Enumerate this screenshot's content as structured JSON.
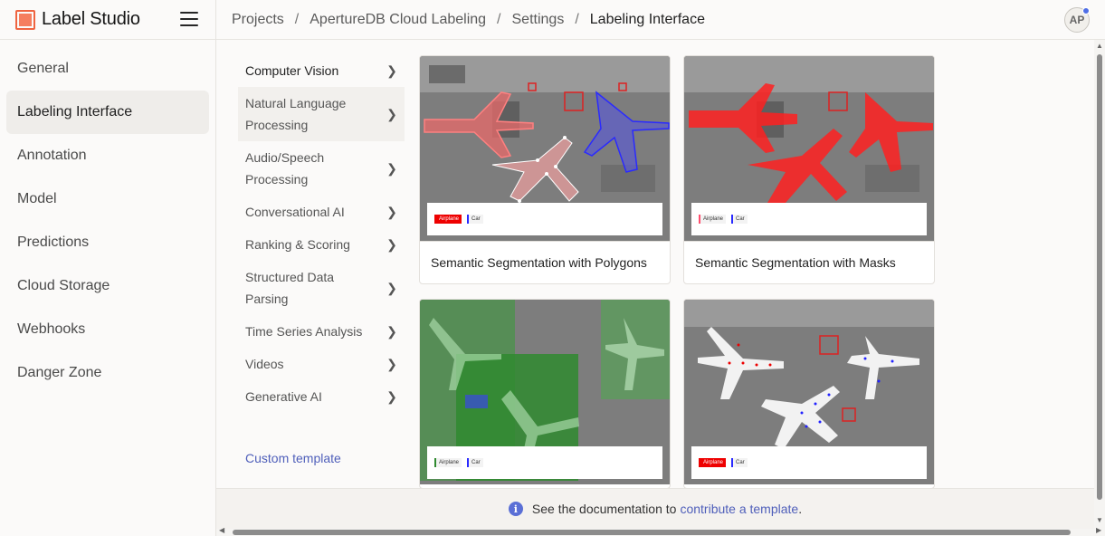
{
  "app": {
    "name": "Label Studio"
  },
  "breadcrumb": [
    "Projects",
    "ApertureDB Cloud Labeling",
    "Settings",
    "Labeling Interface"
  ],
  "breadcrumb_sep": "/",
  "user": {
    "initials": "AP"
  },
  "settings_nav": [
    {
      "label": "General",
      "active": false
    },
    {
      "label": "Labeling Interface",
      "active": true
    },
    {
      "label": "Annotation",
      "active": false
    },
    {
      "label": "Model",
      "active": false
    },
    {
      "label": "Predictions",
      "active": false
    },
    {
      "label": "Cloud Storage",
      "active": false
    },
    {
      "label": "Webhooks",
      "active": false
    },
    {
      "label": "Danger Zone",
      "active": false
    }
  ],
  "categories": [
    {
      "label": "Computer Vision",
      "active": true
    },
    {
      "label": "Natural Language Processing",
      "active": false
    },
    {
      "label": "Audio/Speech Processing",
      "active": false
    },
    {
      "label": "Conversational AI",
      "active": false
    },
    {
      "label": "Ranking & Scoring",
      "active": false
    },
    {
      "label": "Structured Data Parsing",
      "active": false
    },
    {
      "label": "Time Series Analysis",
      "active": false
    },
    {
      "label": "Videos",
      "active": false
    },
    {
      "label": "Generative AI",
      "active": false
    }
  ],
  "custom_template": "Custom template",
  "templates": [
    {
      "title": "Semantic Segmentation with Polygons",
      "labels": [
        "Airplane",
        "Car"
      ]
    },
    {
      "title": "Semantic Segmentation with Masks",
      "labels": [
        "Airplane",
        "Car"
      ]
    },
    {
      "title": "",
      "labels": [
        "Airplane",
        "Car"
      ]
    },
    {
      "title": "",
      "labels": [
        "Airplane",
        "Car"
      ]
    }
  ],
  "doc_bar": {
    "text": "See the documentation to",
    "link": "contribute a template",
    "suffix": "."
  },
  "colors": {
    "accent": "#ef6440",
    "link": "#4f5fba",
    "info": "#5a6fd6"
  }
}
